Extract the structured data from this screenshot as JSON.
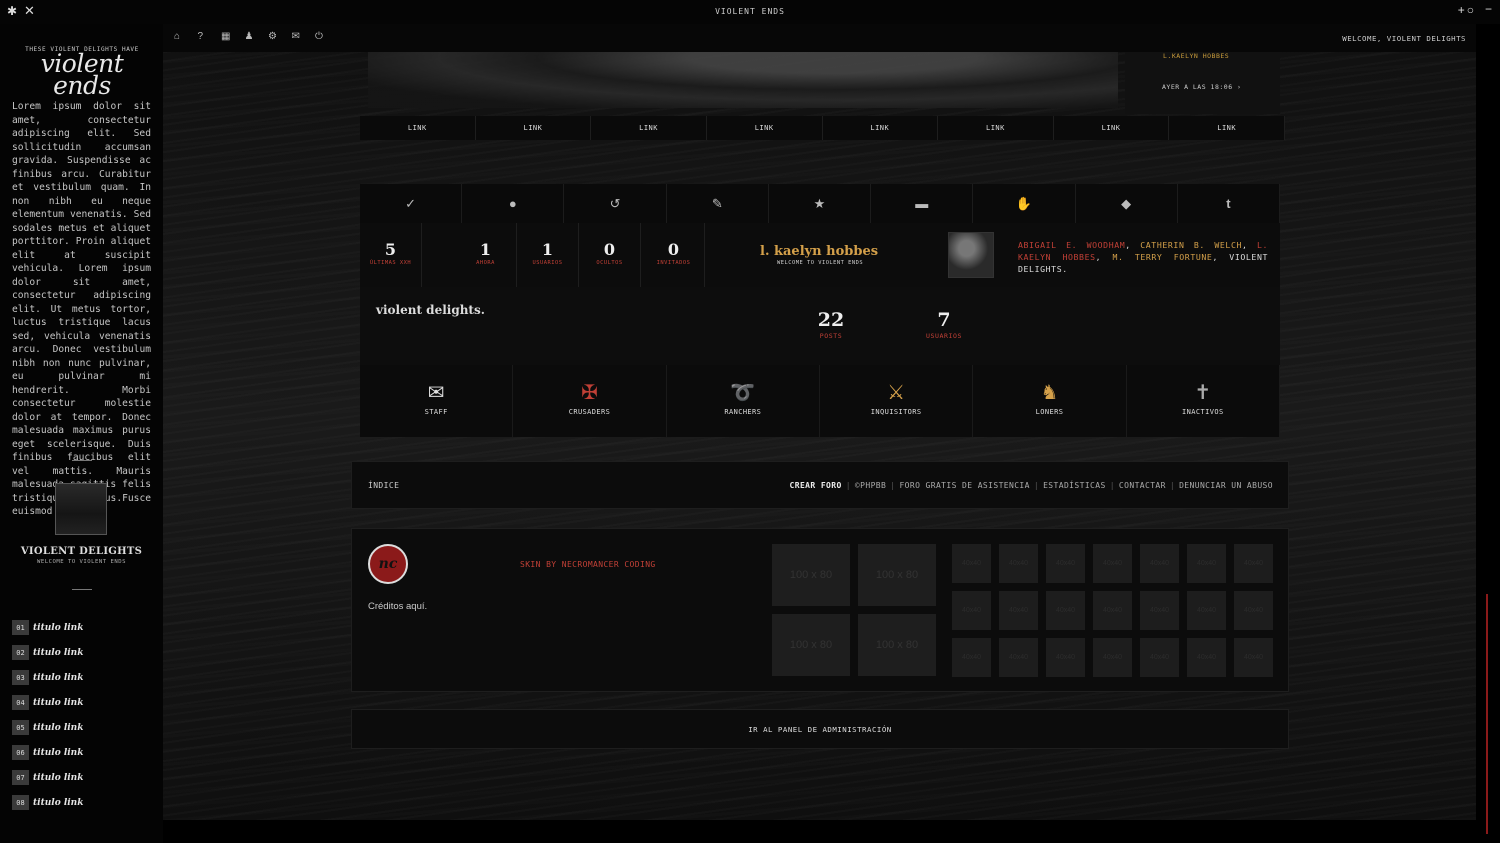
{
  "window": {
    "title": "VIOLENT ENDS"
  },
  "nav": {
    "welcome": "WELCOME, VIOLENT DELIGHTS"
  },
  "sidebar": {
    "tagline": "THESE VIOLENT DELIGHTS HAVE",
    "logo": "violent ends",
    "text": "Lorem ipsum dolor sit amet, consectetur adipiscing elit. Sed sollicitudin accumsan gravida. Suspendisse ac finibus arcu. Curabitur et vestibulum quam. In non nibh eu neque elementum venenatis. Sed sodales metus et aliquet porttitor. Proin aliquet elit at suscipit vehicula. Lorem ipsum dolor sit amet, consectetur adipiscing elit. Ut metus tortor, luctus tristique lacus sed, vehicula venenatis arcu. Donec vestibulum nibh non nunc pulvinar, eu pulvinar mi hendrerit. Morbi consectetur molestie dolor at tempor. Donec malesuada maximus purus eget scelerisque. Duis finibus faucibus elit vel mattis. Mauris malesuada sagittis felis tristique varius.Fusce euismod metus",
    "profile_name": "VIOLENT DELIGHTS",
    "profile_sub": "WELCOME TO VIOLENT ENDS",
    "links": [
      {
        "num": "01",
        "label": "titulo link"
      },
      {
        "num": "02",
        "label": "titulo link"
      },
      {
        "num": "03",
        "label": "titulo link"
      },
      {
        "num": "04",
        "label": "titulo link"
      },
      {
        "num": "05",
        "label": "titulo link"
      },
      {
        "num": "06",
        "label": "titulo link"
      },
      {
        "num": "07",
        "label": "titulo link"
      },
      {
        "num": "08",
        "label": "titulo link"
      }
    ]
  },
  "latest": {
    "author": "L.KAELYN HOBBES",
    "when": "AYER A LAS 18:06 ›"
  },
  "linkbar": [
    "LINK",
    "LINK",
    "LINK",
    "LINK",
    "LINK",
    "LINK",
    "LINK",
    "LINK"
  ],
  "stats": {
    "items": [
      {
        "value": "5",
        "label": "ÚLTIMAS XXH"
      },
      {
        "value": "1",
        "label": "AHORA"
      },
      {
        "value": "1",
        "label": "USUARIOS"
      },
      {
        "value": "0",
        "label": "OCULTOS"
      },
      {
        "value": "0",
        "label": "INVITADOS"
      }
    ],
    "user_name": "l. kaelyn hobbes",
    "user_sub": "WELCOME TO VIOLENT ENDS",
    "online": [
      "ABIGAIL E. WOODHAM",
      "CATHERIN B. WELCH",
      "L. KAELYN HOBBES",
      "M. TERRY FORTUNE",
      "VIOLENT DELIGHTS."
    ],
    "forum_name": "violent delights.",
    "posts": {
      "value": "22",
      "label": "POSTS"
    },
    "users": {
      "value": "7",
      "label": "USUARIOS"
    }
  },
  "groups": [
    {
      "label": "STAFF",
      "icon": "book-icon",
      "color": "#e0e0e0"
    },
    {
      "label": "CRUSADERS",
      "icon": "winged-sword-icon",
      "color": "#c14036"
    },
    {
      "label": "RANCHERS",
      "icon": "lasso-icon",
      "color": "#c14036"
    },
    {
      "label": "INQUISITORS",
      "icon": "dagger-icon",
      "color": "#d4a04a"
    },
    {
      "label": "LONERS",
      "icon": "cloaked-figure-icon",
      "color": "#d4a04a"
    },
    {
      "label": "INACTIVOS",
      "icon": "cross-grave-icon",
      "color": "#aaaaaa"
    }
  ],
  "footer": {
    "index": "ÍNDICE",
    "create": "CREAR FORO",
    "links": [
      "©PHPBB",
      "FORO GRATIS DE ASISTENCIA",
      "ESTADÍSTICAS",
      "CONTACTAR",
      "DENUNCIAR UN ABUSO"
    ]
  },
  "credits": {
    "logo_text": "nc",
    "skin": "SKIN BY NECROMANCER CODING",
    "text": "Créditos aquí.",
    "ad_label": "100 x 80",
    "square_label": "40x40"
  },
  "admin": {
    "label": "IR AL PANEL DE ADMINISTRACIÓN"
  },
  "colors": {
    "accent_red": "#c14036",
    "accent_gold": "#d4a04a"
  }
}
